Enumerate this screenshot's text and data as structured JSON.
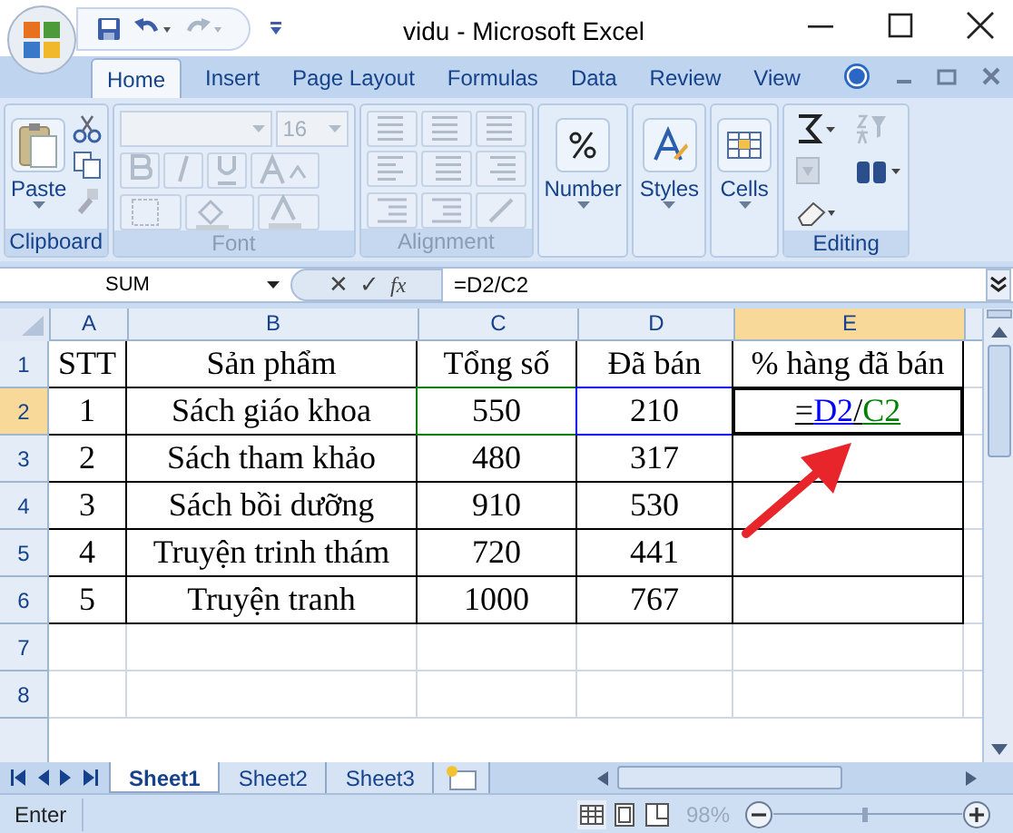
{
  "window": {
    "title": "vidu - Microsoft Excel"
  },
  "ribbon_tabs": [
    {
      "label": "Home",
      "selected": true
    },
    {
      "label": "Insert",
      "selected": false
    },
    {
      "label": "Page Layout",
      "selected": false
    },
    {
      "label": "Formulas",
      "selected": false
    },
    {
      "label": "Data",
      "selected": false
    },
    {
      "label": "Review",
      "selected": false
    },
    {
      "label": "View",
      "selected": false
    }
  ],
  "ribbon_groups": [
    {
      "kind": "clipboard",
      "label": "Clipboard",
      "button": "Paste",
      "disabled": false
    },
    {
      "kind": "font",
      "label": "Font",
      "font_size": "16",
      "disabled": true
    },
    {
      "kind": "alignment",
      "label": "Alignment",
      "disabled": true
    },
    {
      "kind": "big",
      "button": "Number",
      "disabled": false
    },
    {
      "kind": "big",
      "button": "Styles",
      "disabled": false
    },
    {
      "kind": "big",
      "button": "Cells",
      "disabled": false
    },
    {
      "kind": "editing",
      "label": "Editing",
      "disabled": false
    }
  ],
  "formula_bar": {
    "name_box": "SUM",
    "cancel": "✕",
    "enter": "✓",
    "fx": "fx",
    "formula": "=D2/C2"
  },
  "columns": [
    {
      "label": "A",
      "selected": false
    },
    {
      "label": "B",
      "selected": false
    },
    {
      "label": "C",
      "selected": false
    },
    {
      "label": "D",
      "selected": false
    },
    {
      "label": "E",
      "selected": true
    }
  ],
  "rows": [
    {
      "label": "1",
      "selected": false,
      "bordered": true,
      "cells": [
        {
          "text": "STT"
        },
        {
          "text": "Sản phẩm"
        },
        {
          "text": "Tổng số"
        },
        {
          "text": "Đã bán"
        },
        {
          "text": "% hàng đã bán"
        }
      ]
    },
    {
      "label": "2",
      "selected": true,
      "bordered": true,
      "cells": [
        {
          "text": "1"
        },
        {
          "text": "Sách giáo khoa"
        },
        {
          "text": "550",
          "color": "#008000"
        },
        {
          "text": "210",
          "color": "#0000ff"
        },
        {
          "active": true,
          "formula_parts": [
            {
              "text": "="
            },
            {
              "text": "D2",
              "color": "#0000ff"
            },
            {
              "text": "/"
            },
            {
              "text": "C2",
              "color": "#008000"
            }
          ]
        }
      ]
    },
    {
      "label": "3",
      "selected": false,
      "bordered": true,
      "cells": [
        {
          "text": "2"
        },
        {
          "text": "Sách tham khảo"
        },
        {
          "text": "480"
        },
        {
          "text": "317"
        }
      ]
    },
    {
      "label": "4",
      "selected": false,
      "bordered": true,
      "cells": [
        {
          "text": "3"
        },
        {
          "text": "Sách bồi dưỡng"
        },
        {
          "text": "910"
        },
        {
          "text": "530"
        }
      ]
    },
    {
      "label": "5",
      "selected": false,
      "bordered": true,
      "cells": [
        {
          "text": "4"
        },
        {
          "text": "Truyện trinh thám"
        },
        {
          "text": "720"
        },
        {
          "text": "441"
        }
      ]
    },
    {
      "label": "6",
      "selected": false,
      "bordered": true,
      "cells": [
        {
          "text": "5"
        },
        {
          "text": "Truyện tranh"
        },
        {
          "text": "1000"
        },
        {
          "text": "767"
        }
      ]
    },
    {
      "label": "7",
      "selected": false,
      "bordered": false
    },
    {
      "label": "8",
      "selected": false,
      "bordered": false
    }
  ],
  "sheet_tabs": [
    {
      "label": "Sheet1",
      "selected": true
    },
    {
      "label": "Sheet2",
      "selected": false
    },
    {
      "label": "Sheet3",
      "selected": false
    }
  ],
  "status_bar": {
    "mode": "Enter",
    "zoom": "98%",
    "zoom_slider": {
      "level": 0.49
    }
  }
}
